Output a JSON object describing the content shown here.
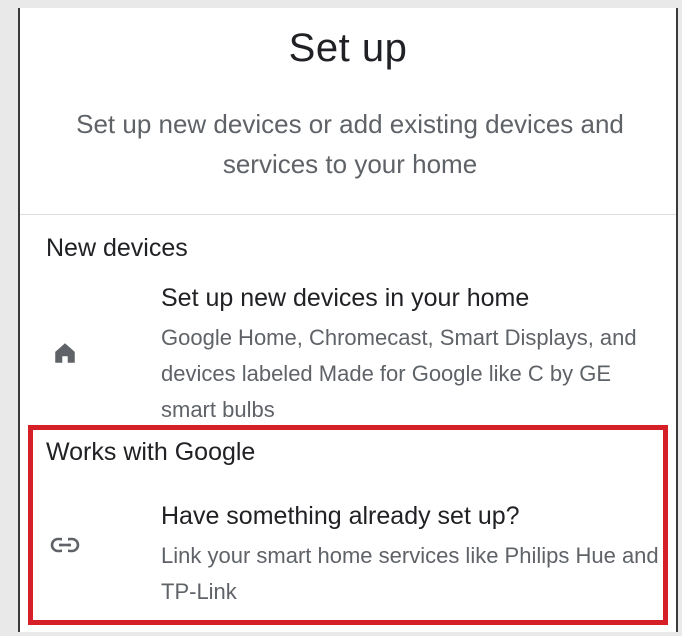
{
  "header": {
    "title": "Set up",
    "subtitle": "Set up new devices or add existing devices and services to your home"
  },
  "sections": {
    "new_devices": {
      "title": "New devices",
      "item": {
        "icon": "home-icon",
        "title": "Set up new devices in your home",
        "description": "Google Home, Chromecast, Smart Displays, and devices labeled Made for Google like C by GE smart bulbs"
      }
    },
    "works_with_google": {
      "title": "Works with Google",
      "item": {
        "icon": "link-icon",
        "title": "Have something already set up?",
        "description": "Link your smart home services like Philips Hue and TP-Link"
      }
    }
  },
  "colors": {
    "highlight": "#d62027",
    "primary_text": "#202124",
    "secondary_text": "#5f6368"
  }
}
